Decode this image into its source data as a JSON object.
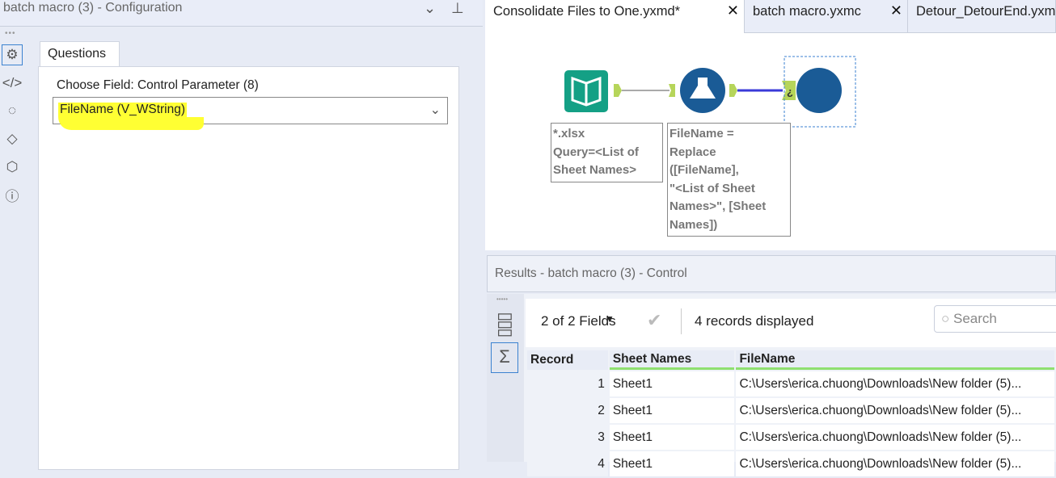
{
  "config": {
    "title": "batch macro (3) - Configuration",
    "tab": "Questions",
    "field_label": "Choose Field: Control Parameter (8)",
    "field_value": "FileName (V_WString)",
    "side_icons": [
      "gear-icon",
      "code-icon",
      "connection-icon",
      "tag-icon",
      "box-icon",
      "help-icon"
    ]
  },
  "tabs": [
    {
      "label": "Consolidate Files to One.yxmd*"
    },
    {
      "label": "batch macro.yxmc"
    },
    {
      "label": "Detour_DetourEnd.yxm"
    }
  ],
  "canvas": {
    "input_annotation": [
      "*.xlsx",
      "Query=<List of",
      "Sheet Names>"
    ],
    "formula_annotation": [
      "FileName =",
      "Replace",
      "([FileName],",
      "\"<List of Sheet",
      "Names>\", [Sheet",
      "Names])"
    ],
    "connector_label": "¿"
  },
  "results": {
    "title": "Results - batch macro (3) - Control",
    "fields": "2 of 2 Fields",
    "records": "4 records displayed",
    "search_placeholder": "Search",
    "columns": [
      "Record",
      "Sheet Names",
      "FileName"
    ],
    "rows": [
      [
        "1",
        "Sheet1",
        "C:\\Users\\erica.chuong\\Downloads\\New folder (5)..."
      ],
      [
        "2",
        "Sheet1",
        "C:\\Users\\erica.chuong\\Downloads\\New folder (5)..."
      ],
      [
        "3",
        "Sheet1",
        "C:\\Users\\erica.chuong\\Downloads\\New folder (5)..."
      ],
      [
        "4",
        "Sheet1",
        "C:\\Users\\erica.chuong\\Downloads\\New folder (5)..."
      ]
    ]
  },
  "colors": {
    "accent": "#1a5b96",
    "input_tool": "#14a085",
    "highlight": "#ffff33"
  }
}
